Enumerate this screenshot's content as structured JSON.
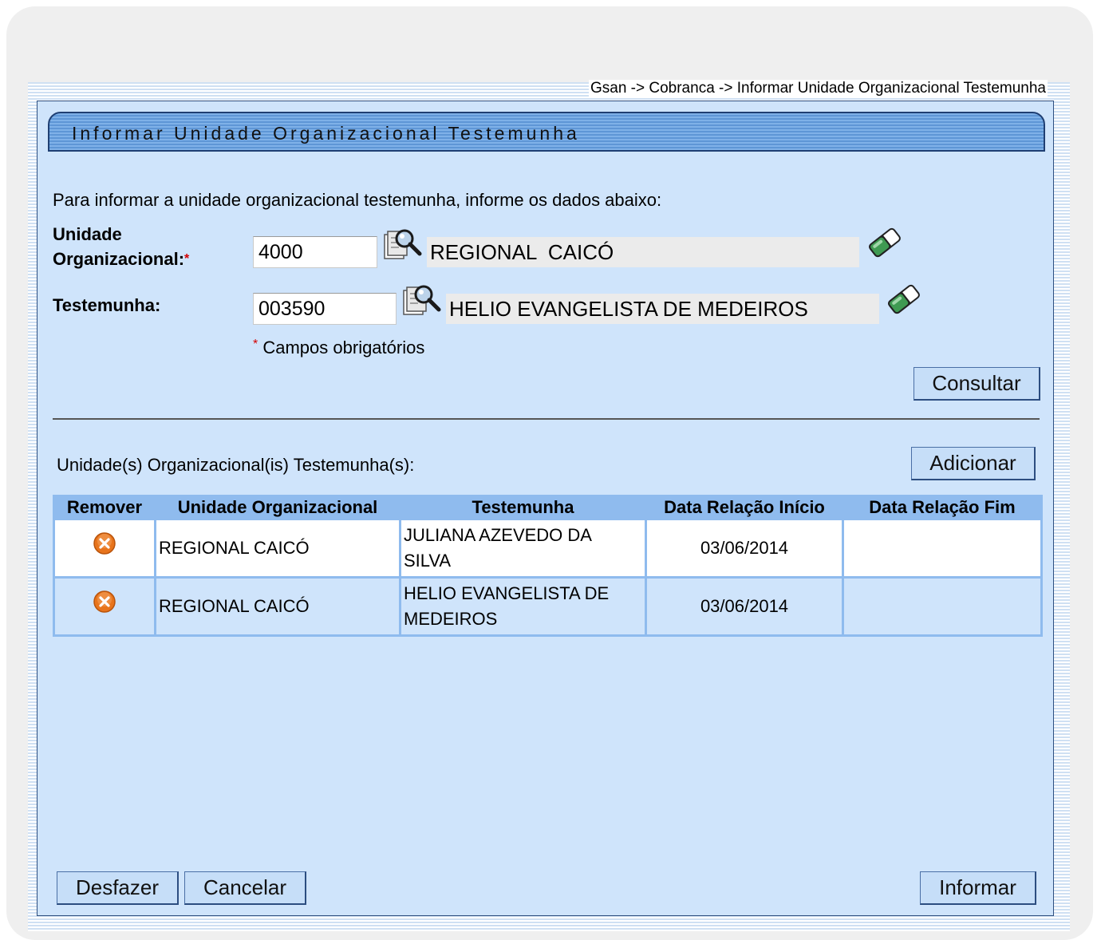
{
  "breadcrumb": "Gsan -> Cobranca -> Informar Unidade Organizacional Testemunha",
  "page_title": "Informar Unidade Organizacional Testemunha",
  "intro": "Para informar a unidade organizacional testemunha, informe os dados abaixo:",
  "form": {
    "unidade_label_1": "Unidade",
    "unidade_label_2": "Organizacional:",
    "required_mark": "*",
    "unidade_code": "4000",
    "unidade_name": "REGIONAL  CAICÓ",
    "testemunha_label": "Testemunha:",
    "testemunha_code": "003590",
    "testemunha_name": "HELIO EVANGELISTA DE MEDEIROS",
    "mandatory_note": "Campos obrigatórios",
    "consultar_label": "Consultar"
  },
  "list": {
    "title": "Unidade(s) Organizacional(is) Testemunha(s):",
    "add_label": "Adicionar",
    "columns": [
      "Remover",
      "Unidade Organizacional",
      "Testemunha",
      "Data Relação Início",
      "Data Relação Fim"
    ],
    "rows": [
      {
        "unidade": "REGIONAL CAICÓ",
        "testemunha": "JULIANA AZEVEDO DA SILVA",
        "inicio": "03/06/2014",
        "fim": ""
      },
      {
        "unidade": "REGIONAL CAICÓ",
        "testemunha": "HELIO EVANGELISTA DE MEDEIROS",
        "inicio": "03/06/2014",
        "fim": ""
      }
    ]
  },
  "footer": {
    "desfazer_label": "Desfazer",
    "cancelar_label": "Cancelar",
    "informar_label": "Informar"
  },
  "icons": {
    "search": "magnifier-icon",
    "clear": "eraser-icon",
    "remove": "remove-x-icon"
  },
  "colors": {
    "panel_bg": "#cfe4fb",
    "title_bar": "#5e96d6",
    "grid_header": "#8fbbee",
    "remove_icon": "#e8741c",
    "required": "#d40000"
  }
}
